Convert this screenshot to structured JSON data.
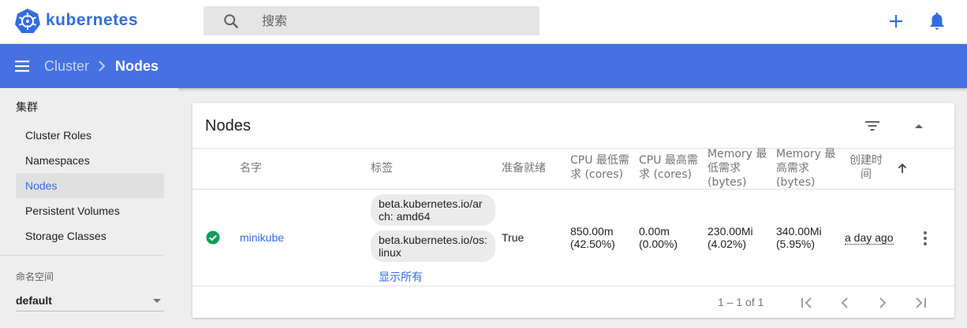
{
  "app": {
    "brand": "kubernetes",
    "brand_color": "#326ce5"
  },
  "search": {
    "placeholder": "搜索"
  },
  "topbar": {
    "create_icon": "plus-icon",
    "notifications_icon": "bell-icon"
  },
  "breadcrumb": {
    "parent": "Cluster",
    "current": "Nodes"
  },
  "sidebar": {
    "section_title": "集群",
    "items": [
      {
        "label": "Cluster Roles"
      },
      {
        "label": "Namespaces"
      },
      {
        "label": "Nodes",
        "active": true
      },
      {
        "label": "Persistent Volumes"
      },
      {
        "label": "Storage Classes"
      }
    ],
    "namespace_label": "命名空间",
    "namespace_value": "default"
  },
  "card": {
    "title": "Nodes",
    "columns": {
      "name": "名字",
      "labels": "标签",
      "ready": "准备就绪",
      "cpu_requests": "CPU 最低需求 (cores)",
      "cpu_limits": "CPU 最高需求 (cores)",
      "mem_requests": "Memory 最低需求 (bytes)",
      "mem_limits": "Memory 最高需求 (bytes)",
      "created": "创建时间"
    },
    "rows": [
      {
        "status": "ready",
        "name": "minikube",
        "labels": [
          "beta.kubernetes.io/arch: amd64",
          "beta.kubernetes.io/os: linux"
        ],
        "show_all": "显示所有",
        "ready": "True",
        "cpu_requests": "850.00m",
        "cpu_requests_pct": "(42.50%)",
        "cpu_limits": "0.00m",
        "cpu_limits_pct": "(0.00%)",
        "mem_requests": "230.00Mi",
        "mem_requests_pct": "(4.02%)",
        "mem_limits": "340.00Mi",
        "mem_limits_pct": "(5.95%)",
        "created": "a day ago"
      }
    ],
    "pagination": {
      "range": "1 – 1 of 1"
    }
  },
  "colors": {
    "header_blue": "#4771e2",
    "ready_green": "#0f9d58"
  }
}
